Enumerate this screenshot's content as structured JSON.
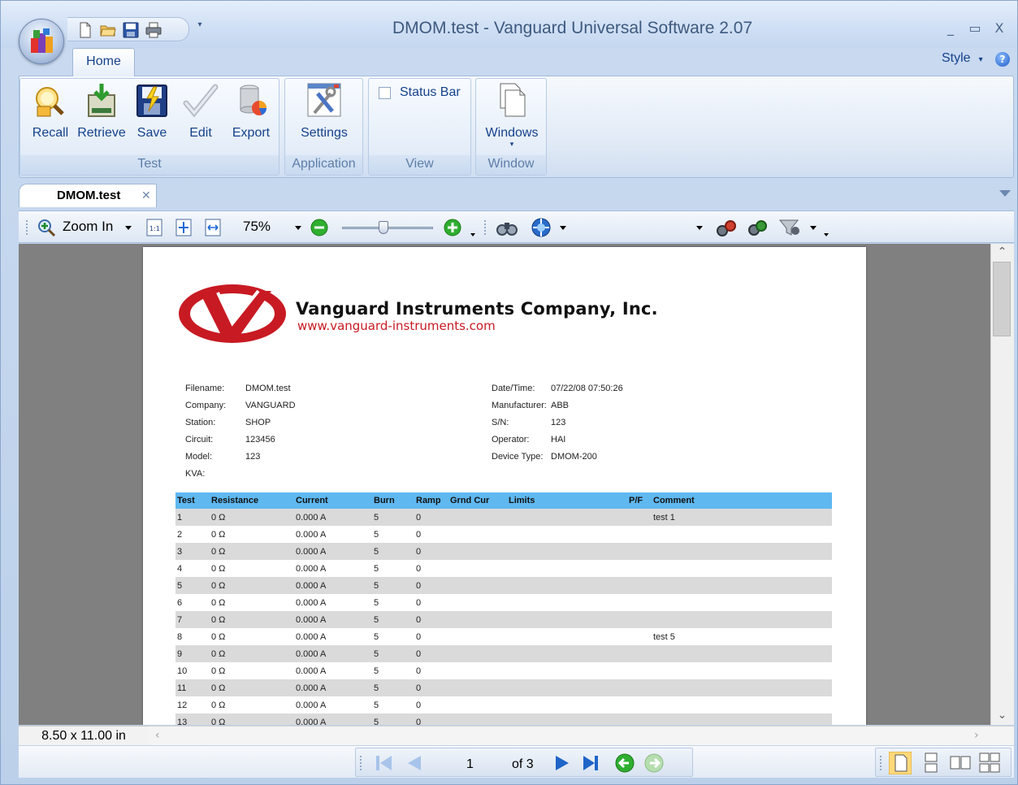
{
  "window": {
    "title": "DMOM.test - Vanguard Universal Software 2.07",
    "minimize": "_",
    "maximize": "▭",
    "close": "X"
  },
  "quick_access": [
    "new-icon",
    "open-icon",
    "save-icon",
    "print-icon"
  ],
  "ribbon": {
    "tabs": [
      {
        "label": "Home"
      }
    ],
    "style_label": "Style",
    "groups": [
      {
        "label": "Test",
        "buttons": [
          "Recall",
          "Retrieve",
          "Save",
          "Edit",
          "Export"
        ]
      },
      {
        "label": "Application",
        "buttons": [
          "Settings"
        ]
      },
      {
        "label": "View",
        "checkbox": {
          "label": "Status Bar",
          "checked": false
        }
      },
      {
        "label": "Window",
        "buttons": [
          "Windows"
        ]
      }
    ]
  },
  "document_tab": {
    "label": "DMOM.test",
    "close": "✕"
  },
  "toolbar": {
    "zoom_in_label": "Zoom In",
    "zoom_level": "75%",
    "zoom_slider_fraction": 0.45
  },
  "report": {
    "company_name": "Vanguard Instruments Company, Inc.",
    "company_url": "www.vanguard-instruments.com",
    "info_left": [
      {
        "label": "Filename:",
        "value": "DMOM.test"
      },
      {
        "label": "Company:",
        "value": "VANGUARD"
      },
      {
        "label": "Station:",
        "value": "SHOP"
      },
      {
        "label": "Circuit:",
        "value": "123456"
      },
      {
        "label": "Model:",
        "value": "123"
      },
      {
        "label": "KVA:",
        "value": ""
      }
    ],
    "info_right": [
      {
        "label": "Date/Time:",
        "value": "07/22/08 07:50:26"
      },
      {
        "label": "Manufacturer:",
        "value": "ABB"
      },
      {
        "label": "S/N:",
        "value": "123"
      },
      {
        "label": "Operator:",
        "value": "HAI"
      },
      {
        "label": "Device Type:",
        "value": "DMOM-200"
      }
    ],
    "columns": [
      "Test",
      "Resistance",
      "Current",
      "Burn",
      "Ramp",
      "Grnd Cur",
      "Limits",
      "P/F",
      "Comment"
    ],
    "rows": [
      [
        "1",
        "0 Ω",
        "0.000  A",
        "5",
        "0",
        "",
        "",
        "",
        "test 1"
      ],
      [
        "2",
        "0 Ω",
        "0.000  A",
        "5",
        "0",
        "",
        "",
        "",
        ""
      ],
      [
        "3",
        "0 Ω",
        "0.000  A",
        "5",
        "0",
        "",
        "",
        "",
        ""
      ],
      [
        "4",
        "0 Ω",
        "0.000  A",
        "5",
        "0",
        "",
        "",
        "",
        ""
      ],
      [
        "5",
        "0 Ω",
        "0.000  A",
        "5",
        "0",
        "",
        "",
        "",
        ""
      ],
      [
        "6",
        "0 Ω",
        "0.000  A",
        "5",
        "0",
        "",
        "",
        "",
        ""
      ],
      [
        "7",
        "0 Ω",
        "0.000  A",
        "5",
        "0",
        "",
        "",
        "",
        ""
      ],
      [
        "8",
        "0 Ω",
        "0.000  A",
        "5",
        "0",
        "",
        "",
        "",
        "test 5"
      ],
      [
        "9",
        "0 Ω",
        "0.000  A",
        "5",
        "0",
        "",
        "",
        "",
        ""
      ],
      [
        "10",
        "0 Ω",
        "0.000  A",
        "5",
        "0",
        "",
        "",
        "",
        ""
      ],
      [
        "11",
        "0 Ω",
        "0.000  A",
        "5",
        "0",
        "",
        "",
        "",
        ""
      ],
      [
        "12",
        "0 Ω",
        "0.000  A",
        "5",
        "0",
        "",
        "",
        "",
        ""
      ],
      [
        "13",
        "0 Ω",
        "0.000  A",
        "5",
        "0",
        "",
        "",
        "",
        ""
      ]
    ]
  },
  "status": {
    "page_size": "8.50 x 11.00 in",
    "current_page": "1",
    "page_of": "of 3"
  },
  "colors": {
    "table_header": "#5fb8f0",
    "alt_row": "#dadada",
    "logo_red": "#c81a22",
    "preview_bg": "#808080"
  }
}
